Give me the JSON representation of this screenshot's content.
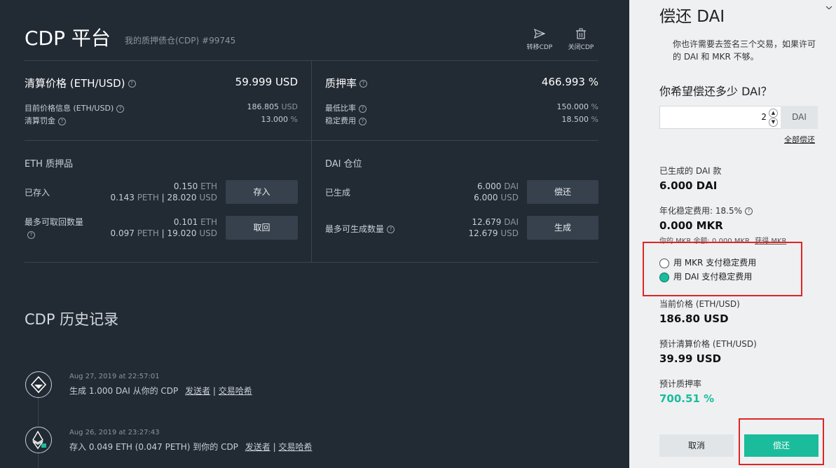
{
  "header": {
    "title": "CDP 平台",
    "subtitle": "我的质押债仓(CDP) #99745",
    "transfer_label": "转移CDP",
    "close_label": "关闭CDP"
  },
  "liquidation": {
    "label": "清算价格 (ETH/USD)",
    "value": "59.999",
    "unit": "USD",
    "current_price_label": "目前价格信息 (ETH/USD)",
    "current_price_value": "186.805",
    "current_price_unit": "USD",
    "penalty_label": "清算罚金",
    "penalty_value": "13.000",
    "penalty_unit": "%"
  },
  "collat_ratio": {
    "label": "质押率",
    "value": "466.993",
    "unit": "%",
    "min_ratio_label": "最低比率",
    "min_ratio_value": "150.000",
    "min_ratio_unit": "%",
    "stability_fee_label": "稳定费用",
    "stability_fee_value": "18.500",
    "stability_fee_unit": "%"
  },
  "eth": {
    "section_title": "ETH 质押品",
    "deposited_label": "已存入",
    "deposited_eth": "0.150",
    "eth_unit": "ETH",
    "deposited_peth": "0.143",
    "peth_unit": "PETH",
    "deposited_usd": "28.020",
    "usd_unit": "USD",
    "deposit_button": "存入",
    "max_withdraw_label": "最多可取回数量",
    "withdraw_eth": "0.101",
    "withdraw_peth": "0.097",
    "withdraw_usd": "19.020",
    "withdraw_button": "取回"
  },
  "dai": {
    "section_title": "DAI 仓位",
    "generated_label": "已生成",
    "generated_dai": "6.000",
    "dai_unit": "DAI",
    "generated_usd": "6.000",
    "usd_unit": "USD",
    "payback_button": "偿还",
    "max_generate_label": "最多可生成数量",
    "max_dai": "12.679",
    "max_usd": "12.679",
    "generate_button": "生成"
  },
  "history": {
    "title": "CDP 历史记录",
    "sender_link": "发送者",
    "tx_link": "交易哈希",
    "items": [
      {
        "time": "Aug 27, 2019 at 22:57:01",
        "text": "生成 1.000 DAI 从你的 CDP"
      },
      {
        "time": "Aug 26, 2019 at 23:27:43",
        "text": "存入 0.049 ETH (0.047 PETH) 到你的 CDP"
      }
    ]
  },
  "panel": {
    "title": "偿还 DAI",
    "notice": "你也许需要去签名三个交易，如果许可的 DAI 和 MKR 不够。",
    "question": "你希望偿还多少 DAI？",
    "amount_value": "2",
    "amount_unit": "DAI",
    "repay_all_link": "全部偿还",
    "generated_label": "已生成的 DAI 款",
    "generated_value": "6.000 DAI",
    "annual_fee_label": "年化稳定费用: 18.5%",
    "fee_value": "0.000 MKR",
    "mkr_balance_label": "你的 MKR 余额: 0.000 MKR",
    "get_mkr_link": "获得 MKR",
    "option_mkr": "用 MKR 支付稳定费用",
    "option_dai": "用 DAI 支付稳定费用",
    "current_price_label": "当前价格 (ETH/USD)",
    "current_price_value": "186.80 USD",
    "proj_liq_label": "预计清算价格 (ETH/USD)",
    "proj_liq_value": "39.99 USD",
    "proj_ratio_label": "预计质押率",
    "proj_ratio_value": "700.51 %",
    "cancel_button": "取消",
    "submit_button": "偿还"
  },
  "colors": {
    "accent": "#1abc9c",
    "highlight_red": "#e02424",
    "background": "#222a33"
  }
}
